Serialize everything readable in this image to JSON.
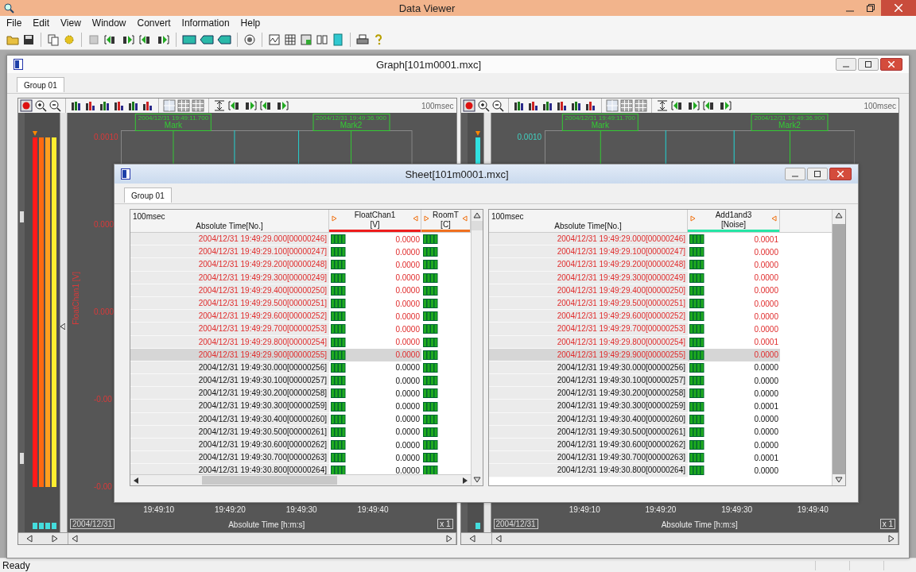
{
  "app": {
    "title": "Data Viewer",
    "menu": [
      "File",
      "Edit",
      "View",
      "Window",
      "Convert",
      "Information",
      "Help"
    ],
    "status": "Ready"
  },
  "graph_window": {
    "title": "Graph[101m0001.mxc]",
    "tabs": [
      {
        "label": "Group 01",
        "selected": true
      }
    ],
    "panes": [
      {
        "rate": "100msec",
        "color": "#d83a3a",
        "channels": [
          {
            "color": "#ff1a1a"
          },
          {
            "color": "#ff6a10"
          },
          {
            "color": "#ffa020"
          },
          {
            "color": "#ffee30"
          }
        ],
        "marks": [
          {
            "time": "2004/12/31 19:49:11.700",
            "label": "Mark"
          },
          {
            "time": "2004/12/31 19:49:36.900",
            "label": "Mark2"
          }
        ],
        "y_ticks": [
          "0.0010",
          "0.000",
          "0.000",
          "-0.00",
          "-0.00"
        ],
        "y_label": "FloatChan1 [V]",
        "date": "2004/12/31",
        "x_ticks": [
          "19:49:10",
          "19:49:20",
          "19:49:30",
          "19:49:40"
        ],
        "x_label": "Absolute Time [h:m:s]",
        "zoom": "x 1"
      },
      {
        "rate": "100msec",
        "color": "#40d0c0",
        "channels": [
          {
            "color": "#30e0e0"
          }
        ],
        "marks": [
          {
            "time": "2004/12/31 19:49:11.700",
            "label": "Mark"
          },
          {
            "time": "2004/12/31 19:49:36.900",
            "label": "Mark2"
          }
        ],
        "y_ticks": [
          "0.0010"
        ],
        "date": "2004/12/31",
        "x_ticks": [
          "19:49:10",
          "19:49:20",
          "19:49:30",
          "19:49:40"
        ],
        "x_label": "Absolute Time [h:m:s]",
        "zoom": "x 1"
      }
    ]
  },
  "sheet_window": {
    "title": "Sheet[101m0001.mxc]",
    "tabs": [
      {
        "label": "Group 01",
        "selected": true
      }
    ],
    "tables": [
      {
        "rate": "100msec",
        "time_header": "Absolute Time[No.]",
        "channels": [
          {
            "name": "FloatChan1",
            "unit": "[V]",
            "color": "#ee1c1c"
          },
          {
            "name": "RoomT",
            "unit": "[C]",
            "color": "#f07020"
          }
        ],
        "rows": [
          {
            "time": "2004/12/31 19:49:29.000[00000246]",
            "marked": true,
            "selected": false,
            "values": [
              "0.0000"
            ]
          },
          {
            "time": "2004/12/31 19:49:29.100[00000247]",
            "marked": true,
            "selected": false,
            "values": [
              "0.0000"
            ]
          },
          {
            "time": "2004/12/31 19:49:29.200[00000248]",
            "marked": true,
            "selected": false,
            "values": [
              "0.0000"
            ]
          },
          {
            "time": "2004/12/31 19:49:29.300[00000249]",
            "marked": true,
            "selected": false,
            "values": [
              "0.0000"
            ]
          },
          {
            "time": "2004/12/31 19:49:29.400[00000250]",
            "marked": true,
            "selected": false,
            "values": [
              "0.0000"
            ]
          },
          {
            "time": "2004/12/31 19:49:29.500[00000251]",
            "marked": true,
            "selected": false,
            "values": [
              "0.0000"
            ]
          },
          {
            "time": "2004/12/31 19:49:29.600[00000252]",
            "marked": true,
            "selected": false,
            "values": [
              "0.0000"
            ]
          },
          {
            "time": "2004/12/31 19:49:29.700[00000253]",
            "marked": true,
            "selected": false,
            "values": [
              "0.0000"
            ]
          },
          {
            "time": "2004/12/31 19:49:29.800[00000254]",
            "marked": true,
            "selected": false,
            "values": [
              "0.0000"
            ]
          },
          {
            "time": "2004/12/31 19:49:29.900[00000255]",
            "marked": true,
            "selected": true,
            "values": [
              "0.0000"
            ]
          },
          {
            "time": "2004/12/31 19:49:30.000[00000256]",
            "marked": false,
            "selected": false,
            "values": [
              "0.0000"
            ]
          },
          {
            "time": "2004/12/31 19:49:30.100[00000257]",
            "marked": false,
            "selected": false,
            "values": [
              "0.0000"
            ]
          },
          {
            "time": "2004/12/31 19:49:30.200[00000258]",
            "marked": false,
            "selected": false,
            "values": [
              "0.0000"
            ]
          },
          {
            "time": "2004/12/31 19:49:30.300[00000259]",
            "marked": false,
            "selected": false,
            "values": [
              "0.0000"
            ]
          },
          {
            "time": "2004/12/31 19:49:30.400[00000260]",
            "marked": false,
            "selected": false,
            "values": [
              "0.0000"
            ]
          },
          {
            "time": "2004/12/31 19:49:30.500[00000261]",
            "marked": false,
            "selected": false,
            "values": [
              "0.0000"
            ]
          },
          {
            "time": "2004/12/31 19:49:30.600[00000262]",
            "marked": false,
            "selected": false,
            "values": [
              "0.0000"
            ]
          },
          {
            "time": "2004/12/31 19:49:30.700[00000263]",
            "marked": false,
            "selected": false,
            "values": [
              "0.0000"
            ]
          },
          {
            "time": "2004/12/31 19:49:30.800[00000264]",
            "marked": false,
            "selected": false,
            "values": [
              "0.0000"
            ]
          }
        ]
      },
      {
        "rate": "100msec",
        "time_header": "Absolute Time[No.]",
        "channels": [
          {
            "name": "Add1and3",
            "unit": "[Noise]",
            "color": "#26e6a6"
          }
        ],
        "rows": [
          {
            "time": "2004/12/31 19:49:29.000[00000246]",
            "marked": true,
            "selected": false,
            "values": [
              "0.0001"
            ]
          },
          {
            "time": "2004/12/31 19:49:29.100[00000247]",
            "marked": true,
            "selected": false,
            "values": [
              "0.0000"
            ]
          },
          {
            "time": "2004/12/31 19:49:29.200[00000248]",
            "marked": true,
            "selected": false,
            "values": [
              "0.0000"
            ]
          },
          {
            "time": "2004/12/31 19:49:29.300[00000249]",
            "marked": true,
            "selected": false,
            "values": [
              "0.0000"
            ]
          },
          {
            "time": "2004/12/31 19:49:29.400[00000250]",
            "marked": true,
            "selected": false,
            "values": [
              "0.0000"
            ]
          },
          {
            "time": "2004/12/31 19:49:29.500[00000251]",
            "marked": true,
            "selected": false,
            "values": [
              "0.0000"
            ]
          },
          {
            "time": "2004/12/31 19:49:29.600[00000252]",
            "marked": true,
            "selected": false,
            "values": [
              "0.0000"
            ]
          },
          {
            "time": "2004/12/31 19:49:29.700[00000253]",
            "marked": true,
            "selected": false,
            "values": [
              "0.0000"
            ]
          },
          {
            "time": "2004/12/31 19:49:29.800[00000254]",
            "marked": true,
            "selected": false,
            "values": [
              "0.0001"
            ]
          },
          {
            "time": "2004/12/31 19:49:29.900[00000255]",
            "marked": true,
            "selected": true,
            "values": [
              "0.0000"
            ]
          },
          {
            "time": "2004/12/31 19:49:30.000[00000256]",
            "marked": false,
            "selected": false,
            "values": [
              "0.0000"
            ]
          },
          {
            "time": "2004/12/31 19:49:30.100[00000257]",
            "marked": false,
            "selected": false,
            "values": [
              "0.0000"
            ]
          },
          {
            "time": "2004/12/31 19:49:30.200[00000258]",
            "marked": false,
            "selected": false,
            "values": [
              "0.0000"
            ]
          },
          {
            "time": "2004/12/31 19:49:30.300[00000259]",
            "marked": false,
            "selected": false,
            "values": [
              "0.0001"
            ]
          },
          {
            "time": "2004/12/31 19:49:30.400[00000260]",
            "marked": false,
            "selected": false,
            "values": [
              "0.0000"
            ]
          },
          {
            "time": "2004/12/31 19:49:30.500[00000261]",
            "marked": false,
            "selected": false,
            "values": [
              "0.0000"
            ]
          },
          {
            "time": "2004/12/31 19:49:30.600[00000262]",
            "marked": false,
            "selected": false,
            "values": [
              "0.0000"
            ]
          },
          {
            "time": "2004/12/31 19:49:30.700[00000263]",
            "marked": false,
            "selected": false,
            "values": [
              "0.0001"
            ]
          },
          {
            "time": "2004/12/31 19:49:30.800[00000264]",
            "marked": false,
            "selected": false,
            "values": [
              "0.0000"
            ]
          }
        ]
      }
    ]
  }
}
